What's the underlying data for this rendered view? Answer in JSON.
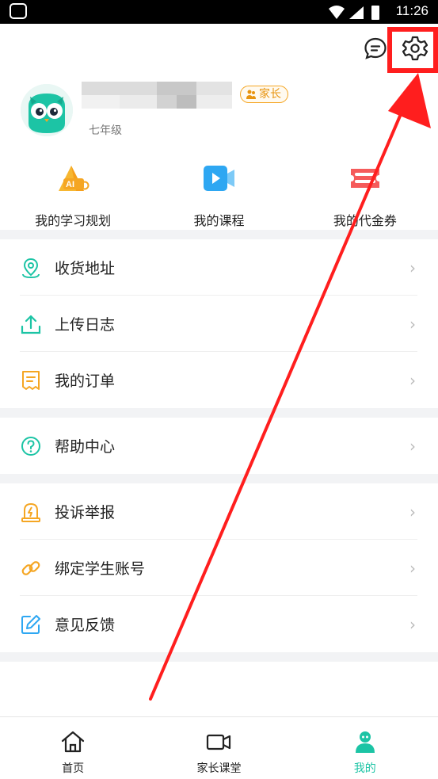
{
  "status": {
    "time": "11:26"
  },
  "profile": {
    "role": "家长",
    "grade": "七年级"
  },
  "quick": [
    {
      "label": "我的学习规划",
      "icon": "ai-plan-icon"
    },
    {
      "label": "我的课程",
      "icon": "video-course-icon"
    },
    {
      "label": "我的代金券",
      "icon": "voucher-icon"
    }
  ],
  "menu": [
    {
      "label": "收货地址",
      "icon": "location-icon"
    },
    {
      "label": "上传日志",
      "icon": "upload-icon"
    },
    {
      "label": "我的订单",
      "icon": "order-icon"
    },
    {
      "label": "帮助中心",
      "icon": "help-icon"
    },
    {
      "label": "投诉举报",
      "icon": "report-icon"
    },
    {
      "label": "绑定学生账号",
      "icon": "link-icon"
    },
    {
      "label": "意见反馈",
      "icon": "feedback-icon"
    }
  ],
  "tabs": [
    {
      "label": "首页",
      "icon": "home-icon"
    },
    {
      "label": "家长课堂",
      "icon": "video-camera-icon"
    },
    {
      "label": "我的",
      "icon": "profile-icon",
      "active": true
    }
  ],
  "colors": {
    "accent": "#1cc4a5",
    "badge": "#f5a623",
    "annotation": "#ff1e1e"
  }
}
